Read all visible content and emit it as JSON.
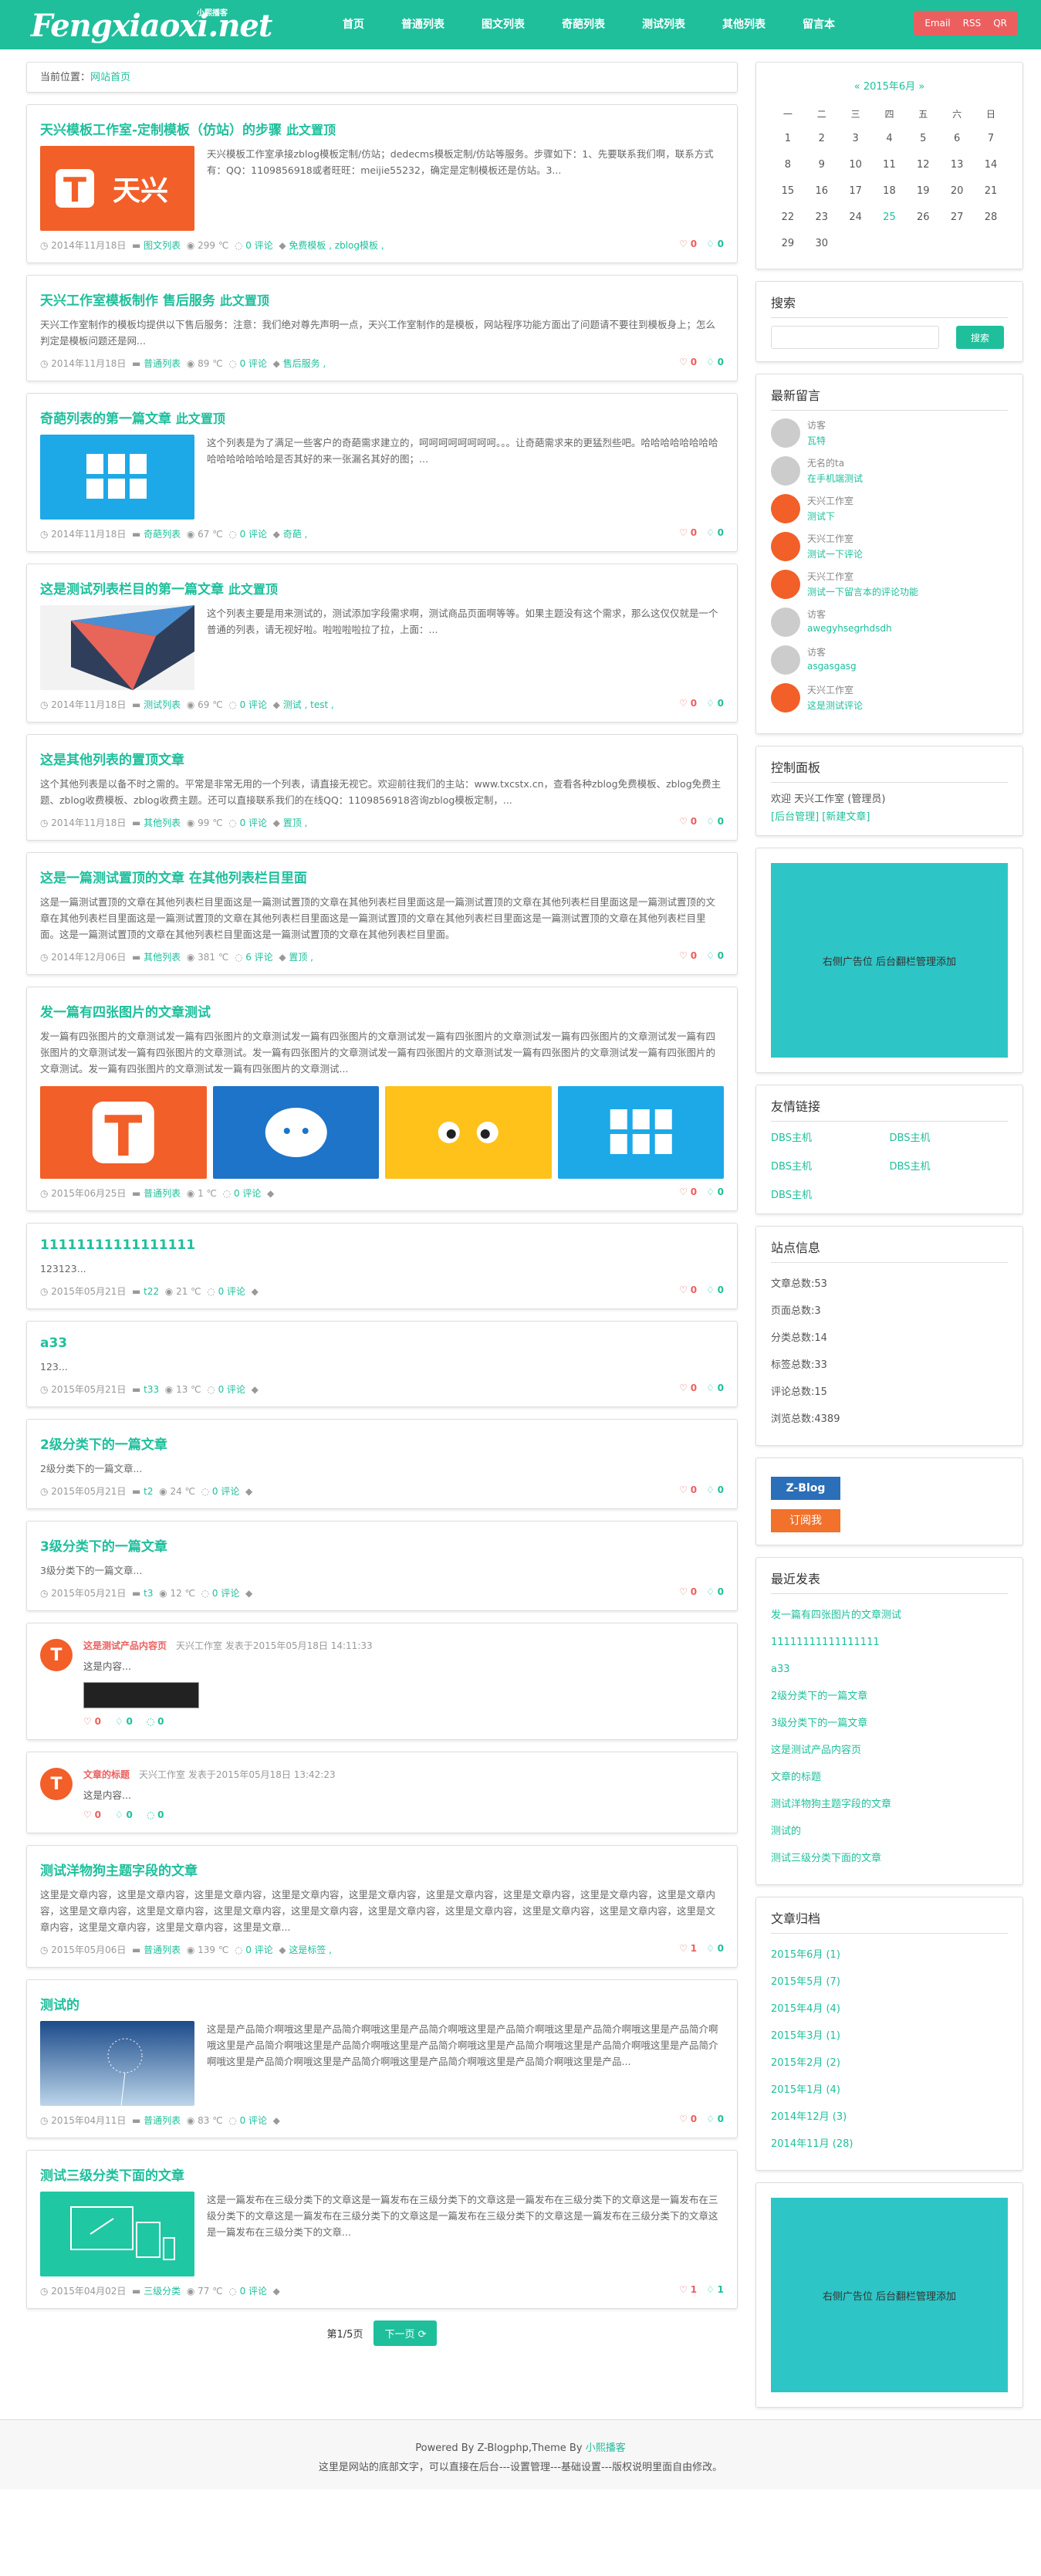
{
  "header": {
    "logo": "Fengxiaoxi.net",
    "logo_tag": "小熙播客",
    "nav": [
      "首页",
      "普通列表",
      "图文列表",
      "奇葩列表",
      "测试列表",
      "其他列表",
      "留言本"
    ],
    "buttons": [
      "Email",
      "RSS",
      "QR"
    ]
  },
  "breadcrumb": {
    "label": "当前位置：",
    "link": "网站首页"
  },
  "posts": [
    {
      "title": "天兴模板工作室-定制模板（仿站）的步骤",
      "sticky": "此文置顶",
      "excerpt": "天兴模板工作室承接zblog模板定制/仿站；dedecms模板定制/仿站等服务。步骤如下：1、先要联系我们啊，联系方式有：QQ：1109856918或者旺旺：meijie55232，确定是定制模板还是仿站。3...",
      "date": "2014年11月18日",
      "cat": "图文列表",
      "views": "299 ℃",
      "comments": "0 评论",
      "tags": "免费模板 , zblog模板 ,",
      "likes": "0",
      "dislikes": "0",
      "thumb": "tianxing"
    },
    {
      "title": "天兴工作室模板制作 售后服务",
      "sticky": "此文置顶",
      "excerpt": "天兴工作室制作的模板均提供以下售后服务：注意：我们绝对尊先声明一点，天兴工作室制作的是模板，网站程序功能方面出了问题请不要往到模板身上；怎么判定是模板问题还是网...",
      "date": "2014年11月18日",
      "cat": "普通列表",
      "views": "89 ℃",
      "comments": "0 评论",
      "tags": "售后服务 ,",
      "likes": "0",
      "dislikes": "0"
    },
    {
      "title": "奇葩列表的第一篇文章",
      "sticky": "此文置顶",
      "excerpt": "这个列表是为了满足一些客户的奇葩需求建立的，呵呵呵呵呵呵呵呵。。。让奇葩需求来的更猛烈些吧。哈哈哈哈哈哈哈哈哈哈哈哈哈哈哈是否其好的来一张漏名其好的图；...",
      "date": "2014年11月18日",
      "cat": "奇葩列表",
      "views": "67 ℃",
      "comments": "0 评论",
      "tags": "奇葩 ,",
      "likes": "0",
      "dislikes": "0",
      "thumb": "grid"
    },
    {
      "title": "这是测试列表栏目的第一篇文章",
      "sticky": "此文置顶",
      "excerpt": "这个列表主要是用来测试的，测试添加字段需求啊，测试商品页面啊等等。如果主题没有这个需求，那么这仅仅就是一个普通的列表，请无视好啦。啦啦啦啦拉了拉，上面：...",
      "date": "2014年11月18日",
      "cat": "测试列表",
      "views": "69 ℃",
      "comments": "0 评论",
      "tags": "测试 , test ,",
      "likes": "0",
      "dislikes": "0",
      "thumb": "fold"
    },
    {
      "title": "这是其他列表的置顶文章",
      "excerpt": "这个其他列表是以备不时之需的。平常是非常无用的一个列表，请直接无视它。欢迎前往我们的主站：www.txcstx.cn，查看各种zblog免费模板、zblog免费主题、zblog收费模板、zblog收费主题。还可以直接联系我们的在线QQ：1109856918咨询zblog模板定制，...",
      "date": "2014年11月18日",
      "cat": "其他列表",
      "views": "99 ℃",
      "comments": "0 评论",
      "tags": "置顶 ,",
      "likes": "0",
      "dislikes": "0"
    },
    {
      "title": "这是一篇测试置顶的文章 在其他列表栏目里面",
      "excerpt": "这是一篇测试置顶的文章在其他列表栏目里面这是一篇测试置顶的文章在其他列表栏目里面这是一篇测试置顶的文章在其他列表栏目里面这是一篇测试置顶的文章在其他列表栏目里面这是一篇测试置顶的文章在其他列表栏目里面这是一篇测试置顶的文章在其他列表栏目里面这是一篇测试置顶的文章在其他列表栏目里面。这是一篇测试置顶的文章在其他列表栏目里面这是一篇测试置顶的文章在其他列表栏目里面。",
      "date": "2014年12月06日",
      "cat": "其他列表",
      "views": "381 ℃",
      "comments": "6 评论",
      "tags": "置顶 ,",
      "likes": "0",
      "dislikes": "0"
    }
  ],
  "fourpost": {
    "title": "发一篇有四张图片的文章测试",
    "excerpt": "发一篇有四张图片的文章测试发一篇有四张图片的文章测试发一篇有四张图片的文章测试发一篇有四张图片的文章测试发一篇有四张图片的文章测试发一篇有四张图片的文章测试发一篇有四张图片的文章测试。发一篇有四张图片的文章测试发一篇有四张图片的文章测试发一篇有四张图片的文章测试发一篇有四张图片的文章测试。发一篇有四张图片的文章测试发一篇有四张图片的文章测试...",
    "date": "2015年06月25日",
    "cat": "普通列表",
    "views": "1 ℃",
    "comments": "0 评论",
    "likes": "0",
    "dislikes": "0"
  },
  "simple": [
    {
      "title": "11111111111111111",
      "excerpt": "123123...",
      "date": "2015年05月21日",
      "cat": "t22",
      "views": "21 ℃",
      "comments": "0 评论",
      "likes": "0",
      "dislikes": "0"
    },
    {
      "title": "a33",
      "excerpt": "123...",
      "date": "2015年05月21日",
      "cat": "t33",
      "views": "13 ℃",
      "comments": "0 评论",
      "likes": "0",
      "dislikes": "0"
    },
    {
      "title": "2级分类下的一篇文章",
      "excerpt": "2级分类下的一篇文章...",
      "date": "2015年05月21日",
      "cat": "t2",
      "views": "24 ℃",
      "comments": "0 评论",
      "likes": "0",
      "dislikes": "0"
    },
    {
      "title": "3级分类下的一篇文章",
      "excerpt": "3级分类下的一篇文章...",
      "date": "2015年05月21日",
      "cat": "t3",
      "views": "12 ℃",
      "comments": "0 评论",
      "likes": "0",
      "dislikes": "0"
    }
  ],
  "tweets": [
    {
      "title": "这是测试产品内容页",
      "by": "天兴工作室 发表于2015年05月18日 14:11:33",
      "body": "这是内容...",
      "likes": "0",
      "dislikes": "0",
      "comments": "0",
      "img": true
    },
    {
      "title": "文章的标题",
      "by": "天兴工作室 发表于2015年05月18日 13:42:23",
      "body": "这是内容...",
      "likes": "0",
      "dislikes": "0",
      "comments": "0"
    }
  ],
  "post3": [
    {
      "title": "测试洋物狗主题字段的文章",
      "excerpt": "这里是文章内容，这里是文章内容，这里是文章内容，这里是文章内容，这里是文章内容，这里是文章内容，这里是文章内容，这里是文章内容，这里是文章内容，这里是文章内容，这里是文章内容，这里是文章内容，这里是文章内容，这里是文章内容，这里是文章内容，这里是文章内容，这里是文章内容，这里是文章内容，这里是文章内容，这里是文章内容，这里是文章...",
      "date": "2015年05月06日",
      "cat": "普通列表",
      "views": "139 ℃",
      "comments": "0 评论",
      "tags": "这是标签 ,",
      "likes": "1",
      "dislikes": "0"
    },
    {
      "title": "测试的",
      "excerpt": "这是是产品简介啊哦这里是产品简介啊哦这里是产品简介啊哦这里是产品简介啊哦这里是产品简介啊哦这里是产品简介啊哦这里是产品简介啊哦这里是产品简介啊哦这里是产品简介啊哦这里是产品简介啊哦这里是产品简介啊哦这里是产品简介啊哦这里是产品简介啊哦这里是产品简介啊哦这里是产品简介啊哦这里是产品简介啊哦这里是产品...",
      "date": "2015年04月11日",
      "cat": "普通列表",
      "views": "83 ℃",
      "comments": "0 评论",
      "likes": "0",
      "dislikes": "0",
      "thumb": "dandelion"
    },
    {
      "title": "测试三级分类下面的文章",
      "excerpt": "这是一篇发布在三级分类下的文章这是一篇发布在三级分类下的文章这是一篇发布在三级分类下的文章这是一篇发布在三级分类下的文章这是一篇发布在三级分类下的文章这是一篇发布在三级分类下的文章这是一篇发布在三级分类下的文章这是一篇发布在三级分类下的文章...",
      "date": "2015年04月02日",
      "cat": "三级分类",
      "views": "77 ℃",
      "comments": "0 评论",
      "likes": "1",
      "dislikes": "1",
      "thumb": "devices"
    }
  ],
  "pager": {
    "info": "第1/5页",
    "next": "下一页 ⟳"
  },
  "calendar": {
    "month": "2015年6月",
    "prev": "«",
    "next": "»",
    "weekdays": [
      "一",
      "二",
      "三",
      "四",
      "五",
      "六",
      "日"
    ],
    "rows": [
      [
        "1",
        "2",
        "3",
        "4",
        "5",
        "6",
        "7"
      ],
      [
        "8",
        "9",
        "10",
        "11",
        "12",
        "13",
        "14"
      ],
      [
        "15",
        "16",
        "17",
        "18",
        "19",
        "20",
        "21"
      ],
      [
        "22",
        "23",
        "24",
        "25",
        "26",
        "27",
        "28"
      ],
      [
        "29",
        "30",
        "",
        "",
        "",
        "",
        ""
      ]
    ]
  },
  "search": {
    "title": "搜索",
    "button": "搜索"
  },
  "comments": {
    "title": "最新留言",
    "items": [
      {
        "name": "访客",
        "text": "瓦特",
        "av": "#ccc"
      },
      {
        "name": "无名的ta",
        "text": "在手机端测试",
        "av": "#ccc"
      },
      {
        "name": "天兴工作室",
        "text": "测试下",
        "av": "#f25f28"
      },
      {
        "name": "天兴工作室",
        "text": "测试一下评论",
        "av": "#f25f28"
      },
      {
        "name": "天兴工作室",
        "text": "测试一下留言本的评论功能",
        "av": "#f25f28"
      },
      {
        "name": "访客",
        "text": "awegyhsegrhdsdh",
        "av": "#ccc"
      },
      {
        "name": "访客",
        "text": "asgasgasg",
        "av": "#ccc"
      },
      {
        "name": "天兴工作室",
        "text": "这是测试评论",
        "av": "#f25f28"
      }
    ]
  },
  "control": {
    "title": "控制面板",
    "welcome": "欢迎 天兴工作室 (管理员)",
    "links": "[后台管理]  [新建文章]"
  },
  "ad": {
    "text": "右侧广告位 后台翻栏管理添加"
  },
  "friends": {
    "title": "友情链接",
    "items": [
      "DBS主机",
      "DBS主机",
      "DBS主机",
      "DBS主机",
      "DBS主机"
    ]
  },
  "stats": {
    "title": "站点信息",
    "items": [
      "文章总数:53",
      "页面总数:3",
      "分类总数:14",
      "标签总数:33",
      "评论总数:15",
      "浏览总数:4389"
    ]
  },
  "badges": {
    "zblog": "Z-Blog",
    "rss": "订阅我"
  },
  "recent": {
    "title": "最近发表",
    "items": [
      "发一篇有四张图片的文章测试",
      "11111111111111111",
      "a33",
      "2级分类下的一篇文章",
      "3级分类下的一篇文章",
      "这是测试产品内容页",
      "文章的标题",
      "测试洋物狗主题字段的文章",
      "测试的",
      "测试三级分类下面的文章"
    ]
  },
  "archive": {
    "title": "文章归档",
    "items": [
      "2015年6月 (1)",
      "2015年5月 (7)",
      "2015年4月 (4)",
      "2015年3月 (1)",
      "2015年2月 (2)",
      "2015年1月 (4)",
      "2014年12月 (3)",
      "2014年11月 (28)"
    ]
  },
  "footer": {
    "line1": "Powered By Z-Blogphp,Theme By",
    "line1_link": "小熙播客",
    "line2": "这里是网站的底部文字，可以直接在后台---设置管理---基础设置---版权说明里面自由修改。"
  },
  "colors": {
    "accent": "#1fbf9c",
    "red": "#ec5f5f",
    "ad": "#2ec5c6"
  }
}
